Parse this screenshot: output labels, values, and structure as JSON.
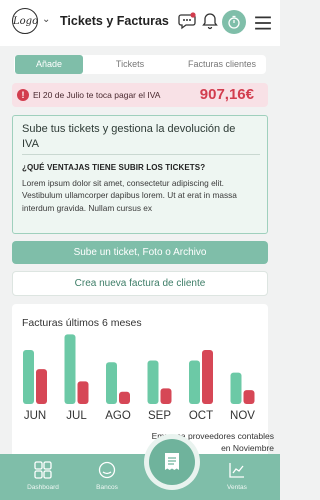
{
  "header": {
    "logo_text": "Logo",
    "title": "Tickets y Facturas",
    "icons": [
      "chat-icon",
      "bell-icon",
      "refresh-icon",
      "menu-icon"
    ]
  },
  "tabs": [
    {
      "label": "Añade",
      "active": true
    },
    {
      "label": "Tickets",
      "active": false
    },
    {
      "label": "Facturas clientes",
      "active": false
    }
  ],
  "alert": {
    "icon": "!",
    "text": "El 20 de Julio te toca pagar el IVA",
    "amount": "907,16€"
  },
  "info_card": {
    "title": "Sube tus tickets y gestiona la devolución de IVA",
    "subtitle": "¿QUÉ VENTAJAS TIENE SUBIR LOS TICKETS?",
    "body": "Lorem ipsum dolor sit amet, consectetur adipiscing elit. Vestibulum ullamcorper dapibus lorem. Ut at erat in massa interdum gravida. Nullam cursus ex"
  },
  "buttons": {
    "upload": "Sube un ticket, Foto o Archivo",
    "new_invoice": "Crea nueva factura de cliente"
  },
  "chart_data": {
    "type": "bar",
    "title": "Facturas últimos 6 meses",
    "categories": [
      "JUN",
      "JUL",
      "AGO",
      "SEP",
      "OCT",
      "NOV"
    ],
    "series": [
      {
        "values": [
          62,
          80,
          48,
          50,
          50,
          36
        ],
        "color": "#6cc9a6"
      },
      {
        "values": [
          40,
          26,
          14,
          18,
          62,
          16
        ],
        "color": "#d64756"
      }
    ],
    "ylim": [
      0,
      85
    ],
    "grid": false
  },
  "note": "Empresa proveedores contables en Noviembre",
  "bottom_nav": {
    "dashboard": "Dashboard",
    "banks": "Bancos",
    "sales": "Ventas"
  },
  "colors": {
    "accent": "#7fbea9",
    "alert": "#d23d4e"
  }
}
